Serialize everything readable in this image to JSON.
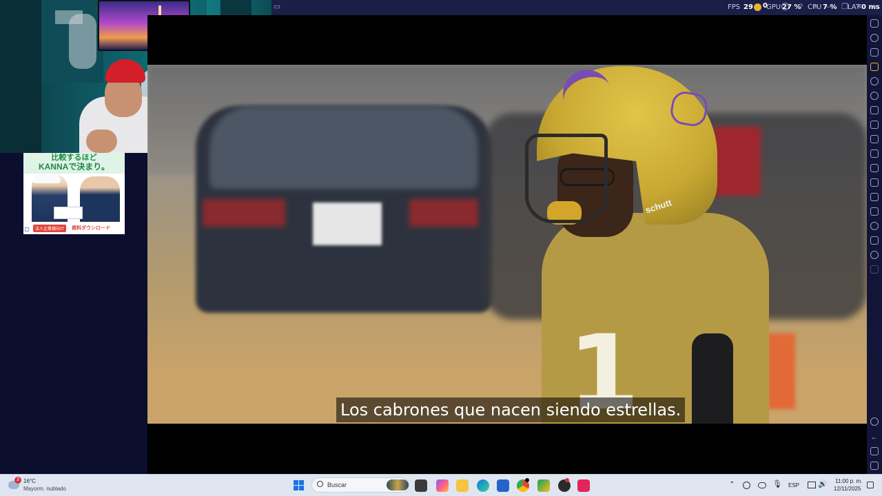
{
  "stats": {
    "fps_label": "FPS",
    "fps_value": "29",
    "coin_value": "0",
    "gpu_label": "GPU",
    "gpu_value": "27 %",
    "cpu_label": "CPU",
    "cpu_value": "7 %",
    "lat_label": "LAT",
    "lat_value": "0 ms"
  },
  "ad": {
    "headline_line1": "比較するほど",
    "headline_line2": "KANNAで決まり。",
    "tag": "法人企業様向け",
    "cta": "資料ダウンロード"
  },
  "video": {
    "subtitle": "Los cabrones que nacen siendo estrellas.",
    "helmet_brand": "schutt",
    "jersey_number": "10"
  },
  "taskbar": {
    "weather_temp": "16°C",
    "weather_desc": "Mayorm. nublado",
    "weather_badge": "3",
    "search_placeholder": "Buscar",
    "language": "ESP",
    "time": "11:00 p. m.",
    "date": "12/11/2025"
  },
  "colors": {
    "accent_window": "#1b1f47",
    "taskbar": "#dfe6f1",
    "helmet_gold": "#c8a832",
    "helmet_purple": "#7a4bb3"
  }
}
